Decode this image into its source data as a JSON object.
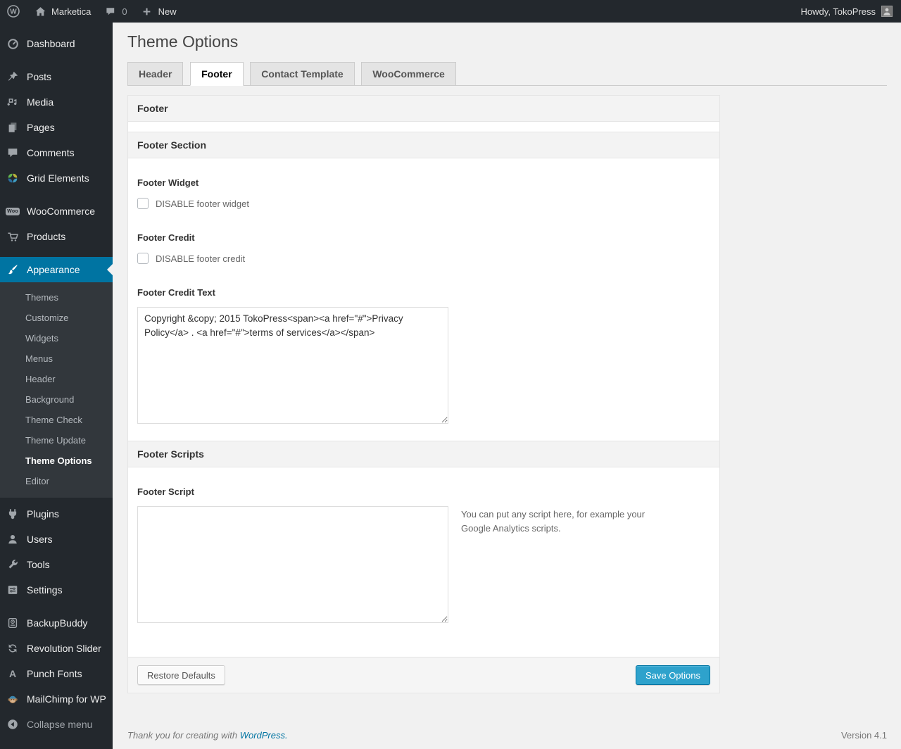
{
  "colors": {
    "accent": "#0074a2",
    "primary_button": "#2ea2cc",
    "admin_dark": "#23282d",
    "submenu_bg": "#32373c",
    "page_bg": "#f1f1f1"
  },
  "admin_bar": {
    "logo_letter": "W",
    "site_name": "Marketica",
    "comment_count": "0",
    "new_label": "New",
    "howdy": "Howdy, TokoPress"
  },
  "sidebar": {
    "items": [
      {
        "label": "Dashboard"
      },
      {
        "label": "Posts"
      },
      {
        "label": "Media"
      },
      {
        "label": "Pages"
      },
      {
        "label": "Comments"
      },
      {
        "label": "Grid Elements"
      },
      {
        "label": "WooCommerce"
      },
      {
        "label": "Products"
      },
      {
        "label": "Appearance"
      },
      {
        "label": "Plugins"
      },
      {
        "label": "Users"
      },
      {
        "label": "Tools"
      },
      {
        "label": "Settings"
      },
      {
        "label": "BackupBuddy"
      },
      {
        "label": "Revolution Slider"
      },
      {
        "label": "Punch Fonts"
      },
      {
        "label": "MailChimp for WP"
      },
      {
        "label": "Collapse menu"
      }
    ],
    "woo_badge": "Woo",
    "punch_letter": "A",
    "appearance_submenu": [
      "Themes",
      "Customize",
      "Widgets",
      "Menus",
      "Header",
      "Background",
      "Theme Check",
      "Theme Update",
      "Theme Options",
      "Editor"
    ]
  },
  "page": {
    "title": "Theme Options",
    "tabs": [
      {
        "label": "Header"
      },
      {
        "label": "Footer"
      },
      {
        "label": "Contact Template"
      },
      {
        "label": "WooCommerce"
      }
    ]
  },
  "panel": {
    "header": "Footer",
    "section_footer": "Footer Section",
    "section_scripts": "Footer Scripts",
    "footer_widget": {
      "label": "Footer Widget",
      "checkbox_label": "DISABLE footer widget"
    },
    "footer_credit": {
      "label": "Footer Credit",
      "checkbox_label": "DISABLE footer credit"
    },
    "footer_credit_text": {
      "label": "Footer Credit Text",
      "value": "Copyright &copy; 2015 TokoPress<span><a href=\"#\">Privacy Policy</a> . <a href=\"#\">terms of services</a></span>"
    },
    "footer_script": {
      "label": "Footer Script",
      "value": "",
      "hint": "You can put any script here, for example your Google Analytics scripts."
    },
    "restore_button": "Restore Defaults",
    "save_button": "Save Options"
  },
  "footer": {
    "thanks": "Thank you for creating with",
    "wordpress_link": "WordPress.",
    "version": "Version 4.1"
  }
}
